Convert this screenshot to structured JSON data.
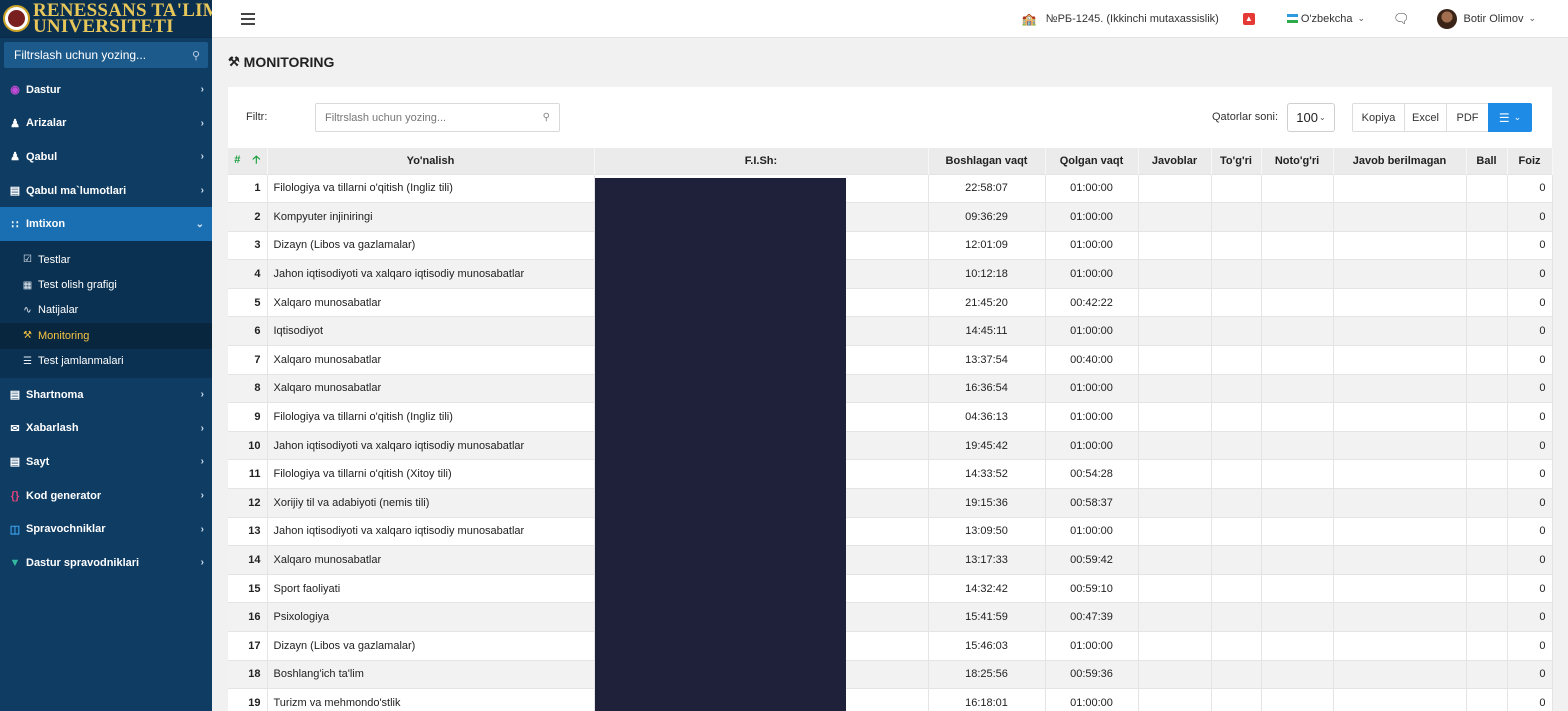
{
  "brand": {
    "line1": "RENESSANS TA'LIM",
    "line2": "UNIVERSITETI"
  },
  "sidebar": {
    "search_placeholder": "Filtrslash uchun yozing...",
    "items": [
      {
        "label": "Dastur",
        "icon": "dastur-icon",
        "color": "#c34ad6"
      },
      {
        "label": "Arizalar",
        "icon": "user-plus-icon",
        "color": "#ffffff"
      },
      {
        "label": "Qabul",
        "icon": "user-icon",
        "color": "#ffffff"
      },
      {
        "label": "Qabul ma`lumotlari",
        "icon": "clipboard-icon",
        "color": "#ffffff"
      },
      {
        "label": "Imtixon",
        "icon": "grid-icon",
        "color": "#ffffff",
        "active": true
      },
      {
        "label": "Shartnoma",
        "icon": "document-icon",
        "color": "#ffffff"
      },
      {
        "label": "Xabarlash",
        "icon": "envelope-icon",
        "color": "#ffffff"
      },
      {
        "label": "Sayt",
        "icon": "window-icon",
        "color": "#ffffff"
      },
      {
        "label": "Kod generator",
        "icon": "code-braces-icon",
        "color": "#e0457b"
      },
      {
        "label": "Spravochniklar",
        "icon": "database-icon",
        "color": "#3ba3ee"
      },
      {
        "label": "Dastur spravodniklari",
        "icon": "car-icon",
        "color": "#35b8a0"
      }
    ],
    "submenu": [
      {
        "label": "Testlar",
        "icon": "calendar-check-icon"
      },
      {
        "label": "Test olish grafigi",
        "icon": "table-icon"
      },
      {
        "label": "Natijalar",
        "icon": "chart-line-icon"
      },
      {
        "label": "Monitoring",
        "icon": "monitoring-icon",
        "active": true
      },
      {
        "label": "Test jamlanmalari",
        "icon": "list-icon"
      }
    ]
  },
  "topbar": {
    "org": "№РБ-1245. (Ikkinchi mutaxassislik)",
    "language": "O'zbekcha",
    "user": "Botir Olimov"
  },
  "page": {
    "title": "MONITORING",
    "filter_label": "Filtr:",
    "filter_placeholder": "Filtrslash uchun yozing...",
    "rows_label": "Qatorlar soni:",
    "rows_value": "100",
    "buttons": {
      "copy": "Kopiya",
      "excel": "Excel",
      "pdf": "PDF"
    }
  },
  "table": {
    "headers": [
      "#",
      "Yo'nalish",
      "F.I.Sh:",
      "Boshlagan vaqt",
      "Qolgan vaqt",
      "Javoblar",
      "To'g'ri",
      "Noto'g'ri",
      "Javob berilmagan",
      "Ball",
      "Foiz"
    ],
    "rows": [
      {
        "n": "1",
        "yonalish": "Filologiya va tillarni o'qitish (Ingliz tili)",
        "start": "22:58:07",
        "left": "01:00:00",
        "foiz": "0"
      },
      {
        "n": "2",
        "yonalish": "Kompyuter injiniringi",
        "start": "09:36:29",
        "left": "01:00:00",
        "foiz": "0"
      },
      {
        "n": "3",
        "yonalish": "Dizayn (Libos va gazlamalar)",
        "start": "12:01:09",
        "left": "01:00:00",
        "foiz": "0"
      },
      {
        "n": "4",
        "yonalish": "Jahon iqtisodiyoti va xalqaro iqtisodiy munosabatlar",
        "start": "10:12:18",
        "left": "01:00:00",
        "foiz": "0"
      },
      {
        "n": "5",
        "yonalish": "Xalqaro munosabatlar",
        "start": "21:45:20",
        "left": "00:42:22",
        "foiz": "0"
      },
      {
        "n": "6",
        "yonalish": "Iqtisodiyot",
        "start": "14:45:11",
        "left": "01:00:00",
        "foiz": "0"
      },
      {
        "n": "7",
        "yonalish": "Xalqaro munosabatlar",
        "start": "13:37:54",
        "left": "00:40:00",
        "foiz": "0"
      },
      {
        "n": "8",
        "yonalish": "Xalqaro munosabatlar",
        "start": "16:36:54",
        "left": "01:00:00",
        "foiz": "0"
      },
      {
        "n": "9",
        "yonalish": "Filologiya va tillarni o'qitish (Ingliz tili)",
        "start": "04:36:13",
        "left": "01:00:00",
        "foiz": "0"
      },
      {
        "n": "10",
        "yonalish": "Jahon iqtisodiyoti va xalqaro iqtisodiy munosabatlar",
        "start": "19:45:42",
        "left": "01:00:00",
        "foiz": "0"
      },
      {
        "n": "11",
        "yonalish": "Filologiya va tillarni o'qitish (Xitoy tili)",
        "start": "14:33:52",
        "left": "00:54:28",
        "foiz": "0"
      },
      {
        "n": "12",
        "yonalish": "Xorijiy til va adabiyoti (nemis tili)",
        "start": "19:15:36",
        "left": "00:58:37",
        "foiz": "0"
      },
      {
        "n": "13",
        "yonalish": "Jahon iqtisodiyoti va xalqaro iqtisodiy munosabatlar",
        "start": "13:09:50",
        "left": "01:00:00",
        "foiz": "0"
      },
      {
        "n": "14",
        "yonalish": "Xalqaro munosabatlar",
        "start": "13:17:33",
        "left": "00:59:42",
        "foiz": "0"
      },
      {
        "n": "15",
        "yonalish": "Sport faoliyati",
        "start": "14:32:42",
        "left": "00:59:10",
        "foiz": "0"
      },
      {
        "n": "16",
        "yonalish": "Psixologiya",
        "start": "15:41:59",
        "left": "00:47:39",
        "foiz": "0"
      },
      {
        "n": "17",
        "yonalish": "Dizayn (Libos va gazlamalar)",
        "start": "15:46:03",
        "left": "01:00:00",
        "foiz": "0"
      },
      {
        "n": "18",
        "yonalish": "Boshlang'ich ta'lim",
        "start": "18:25:56",
        "left": "00:59:36",
        "foiz": "0"
      },
      {
        "n": "19",
        "yonalish": "Turizm va mehmondo'stlik",
        "start": "16:18:01",
        "left": "01:00:00",
        "foiz": "0"
      }
    ]
  }
}
